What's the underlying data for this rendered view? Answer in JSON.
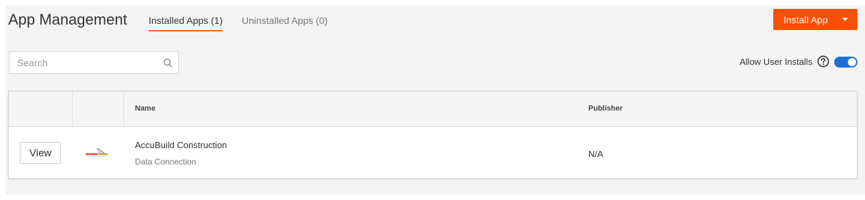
{
  "header": {
    "title": "App Management",
    "tabs": [
      {
        "label": "Installed Apps (1)",
        "active": true
      },
      {
        "label": "Uninstalled Apps (0)",
        "active": false
      }
    ],
    "install_button_label": "Install App"
  },
  "search": {
    "placeholder": "Search",
    "value": ""
  },
  "allow_installs": {
    "label": "Allow User Installs",
    "enabled": true
  },
  "table": {
    "columns": [
      "Name",
      "Publisher"
    ],
    "rows": [
      {
        "action_label": "View",
        "logo_icon": "accubuild-logo",
        "name": "AccuBuild Construction",
        "type": "Data Connection",
        "publisher": "N/A"
      }
    ]
  },
  "colors": {
    "accent": "#fa5002",
    "tab_underline": "#f26322",
    "toggle_on": "#1e6fd9",
    "background": "#f4f4f4"
  }
}
